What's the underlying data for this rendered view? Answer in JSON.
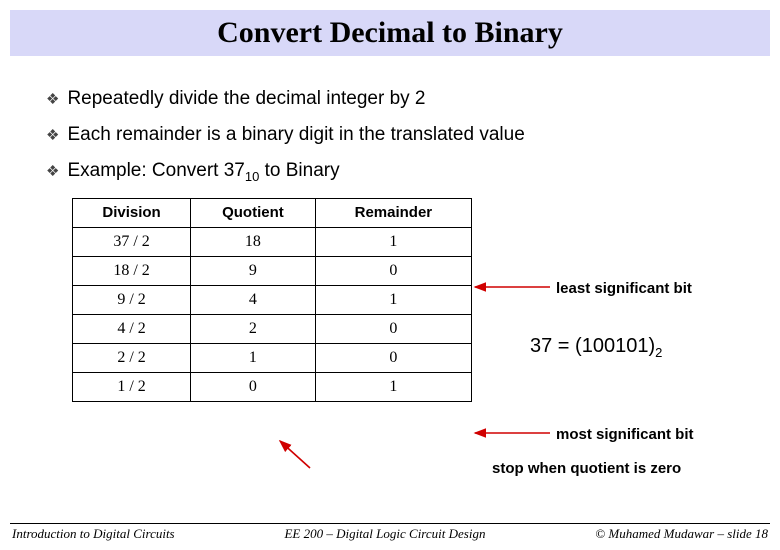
{
  "title": "Convert Decimal to Binary",
  "bullets": {
    "b1": "Repeatedly divide the decimal integer by 2",
    "b2": "Each remainder is a binary digit in the translated value",
    "b3_pre": "Example: Convert 37",
    "b3_sub": "10",
    "b3_post": " to Binary"
  },
  "table": {
    "headers": {
      "c1": "Division",
      "c2": "Quotient",
      "c3": "Remainder"
    },
    "rows": [
      {
        "c1": "37 / 2",
        "c2": "18",
        "c3": "1"
      },
      {
        "c1": "18 / 2",
        "c2": "9",
        "c3": "0"
      },
      {
        "c1": "9 / 2",
        "c2": "4",
        "c3": "1"
      },
      {
        "c1": "4 / 2",
        "c2": "2",
        "c3": "0"
      },
      {
        "c1": "2 / 2",
        "c2": "1",
        "c3": "0"
      },
      {
        "c1": "1 / 2",
        "c2": "0",
        "c3": "1"
      }
    ]
  },
  "annotations": {
    "lsb": "least significant bit",
    "result_pre": "37 = (100101)",
    "result_sub": "2",
    "msb": "most significant bit",
    "stop": "stop when quotient is zero"
  },
  "footer": {
    "left": "Introduction to Digital Circuits",
    "center": "EE 200 – Digital Logic Circuit Design",
    "right": "© Muhamed Mudawar – slide 18"
  },
  "colors": {
    "arrow": "#d00000"
  }
}
